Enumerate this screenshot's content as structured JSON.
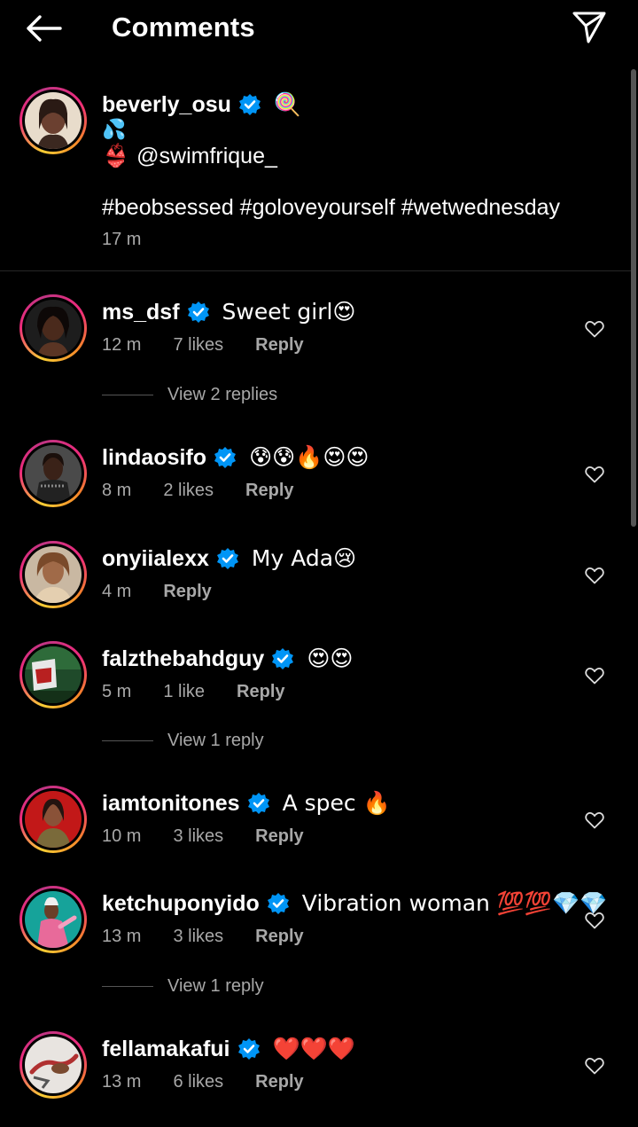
{
  "header": {
    "title": "Comments",
    "back_icon": "arrow-left-icon",
    "send_icon": "paper-plane-icon"
  },
  "caption": {
    "username": "beverly_osu",
    "emoji_after_name": "🍭",
    "line2_emoji": "💦",
    "line3_emoji": "👙",
    "mention": "@swimfrique_",
    "hashtags": "#beobsessed #goloveyourself #wetwednesday",
    "time": "17 m"
  },
  "comments": [
    {
      "username": "ms_dsf",
      "text": "Sweet girl😍",
      "time": "12 m",
      "likes": "7 likes",
      "reply": "Reply",
      "view_replies": "View 2 replies"
    },
    {
      "username": "lindaosifo",
      "text": "😰😰🔥😍😍",
      "time": "8 m",
      "likes": "2 likes",
      "reply": "Reply"
    },
    {
      "username": "onyiialexx",
      "text": "My Ada😢",
      "time": "4 m",
      "likes": "",
      "reply": "Reply"
    },
    {
      "username": "falzthebahdguy",
      "text": "😍😍",
      "time": "5 m",
      "likes": "1 like",
      "reply": "Reply",
      "view_replies": "View 1 reply"
    },
    {
      "username": "iamtonitones",
      "text": "A spec 🔥",
      "time": "10 m",
      "likes": "3 likes",
      "reply": "Reply"
    },
    {
      "username": "ketchuponyido",
      "text": "Vibration woman 💯💯💎💎",
      "time": "13 m",
      "likes": "3 likes",
      "reply": "Reply",
      "view_replies": "View 1 reply"
    },
    {
      "username": "fellamakafui",
      "text": "❤️❤️❤️",
      "time": "13 m",
      "likes": "6 likes",
      "reply": "Reply"
    }
  ],
  "colors": {
    "background": "#000000",
    "text": "#ffffff",
    "secondary_text": "#a8a8a8",
    "verified": "#0095f6"
  }
}
